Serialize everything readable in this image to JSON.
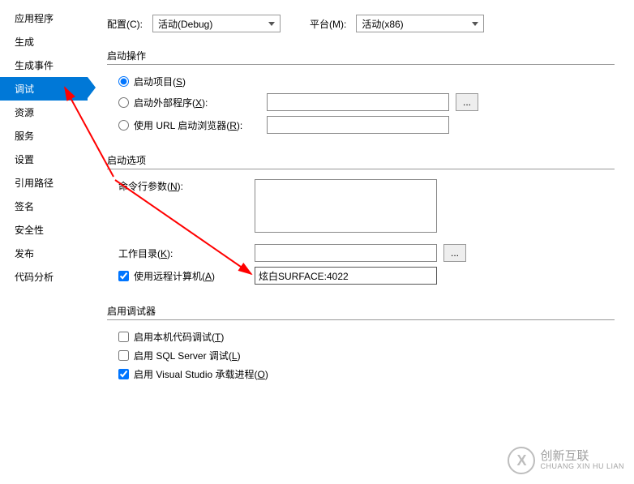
{
  "sidebar": {
    "items": [
      {
        "label": "应用程序"
      },
      {
        "label": "生成"
      },
      {
        "label": "生成事件"
      },
      {
        "label": "调试",
        "selected": true
      },
      {
        "label": "资源"
      },
      {
        "label": "服务"
      },
      {
        "label": "设置"
      },
      {
        "label": "引用路径"
      },
      {
        "label": "签名"
      },
      {
        "label": "安全性"
      },
      {
        "label": "发布"
      },
      {
        "label": "代码分析"
      }
    ]
  },
  "toprow": {
    "config_label": "配置(C):",
    "config_value": "活动(Debug)",
    "platform_label": "平台(M):",
    "platform_value": "活动(x86)"
  },
  "startAction": {
    "legend": "启动操作",
    "opt_project_prefix": "启动项目(",
    "opt_project_key": "S",
    "opt_project_suffix": ")",
    "opt_external_prefix": "启动外部程序(",
    "opt_external_key": "X",
    "opt_external_suffix": "):",
    "opt_url_prefix": "使用 URL 启动浏览器(",
    "opt_url_key": "R",
    "opt_url_suffix": "):",
    "browse": "..."
  },
  "startOptions": {
    "legend": "启动选项",
    "args_prefix": "命令行参数(",
    "args_key": "N",
    "args_suffix": "):",
    "workdir_prefix": "工作目录(",
    "workdir_key": "K",
    "workdir_suffix": "):",
    "remote_prefix": "使用远程计算机(",
    "remote_key": "A",
    "remote_suffix": ")",
    "remote_value": "炫白SURFACE:4022",
    "browse": "..."
  },
  "debuggers": {
    "legend": "启用调试器",
    "native_prefix": "启用本机代码调试(",
    "native_key": "T",
    "native_suffix": ")",
    "sql_prefix": "启用 SQL Server 调试(",
    "sql_key": "L",
    "sql_suffix": ")",
    "vshost_prefix": "启用 Visual Studio 承载进程(",
    "vshost_key": "O",
    "vshost_suffix": ")"
  },
  "watermark": {
    "cn": "创新互联",
    "en": "CHUANG XIN HU LIAN"
  }
}
